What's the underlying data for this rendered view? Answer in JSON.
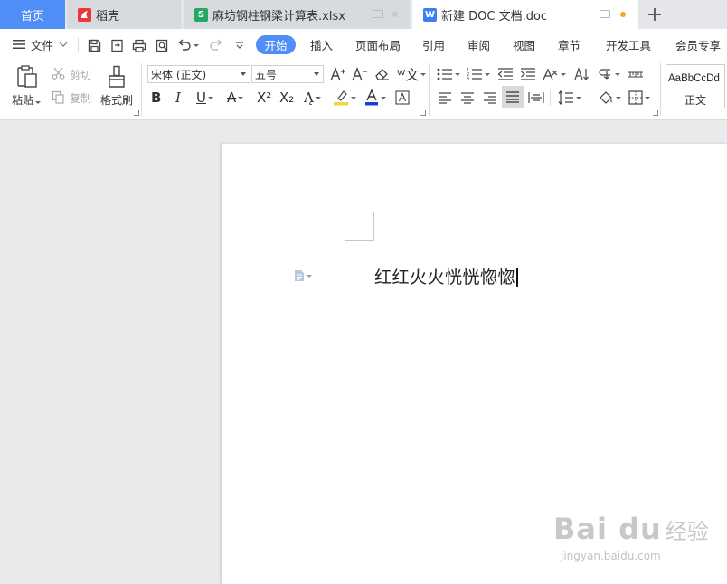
{
  "tabs": {
    "home": "首页",
    "daoke": "稻壳",
    "xlsx": "麻坊钢柱钢梁计算表.xlsx",
    "doc": "新建 DOC 文档.doc",
    "add": "+"
  },
  "menu": {
    "file": "文件",
    "items": [
      "开始",
      "插入",
      "页面布局",
      "引用",
      "审阅",
      "视图",
      "章节",
      "开发工具",
      "会员专享"
    ]
  },
  "ribbon": {
    "paste": "粘贴",
    "cut": "剪切",
    "copy": "复制",
    "format_painter": "格式刷",
    "font_name": "宋体 (正文)",
    "font_size": "五号",
    "style_preview": "AaBbCcDd",
    "style_name": "正文"
  },
  "document": {
    "text": "红红火火恍恍惚惚"
  },
  "watermark": {
    "logo": "Bai du",
    "cn": "经验",
    "url": "jingyan.baidu.com"
  },
  "colors": {
    "accent": "#4e8ef6",
    "highlight": "#f5d33b",
    "font_color": "#1d3fcf",
    "unsaved_dot": "#f5a623"
  }
}
